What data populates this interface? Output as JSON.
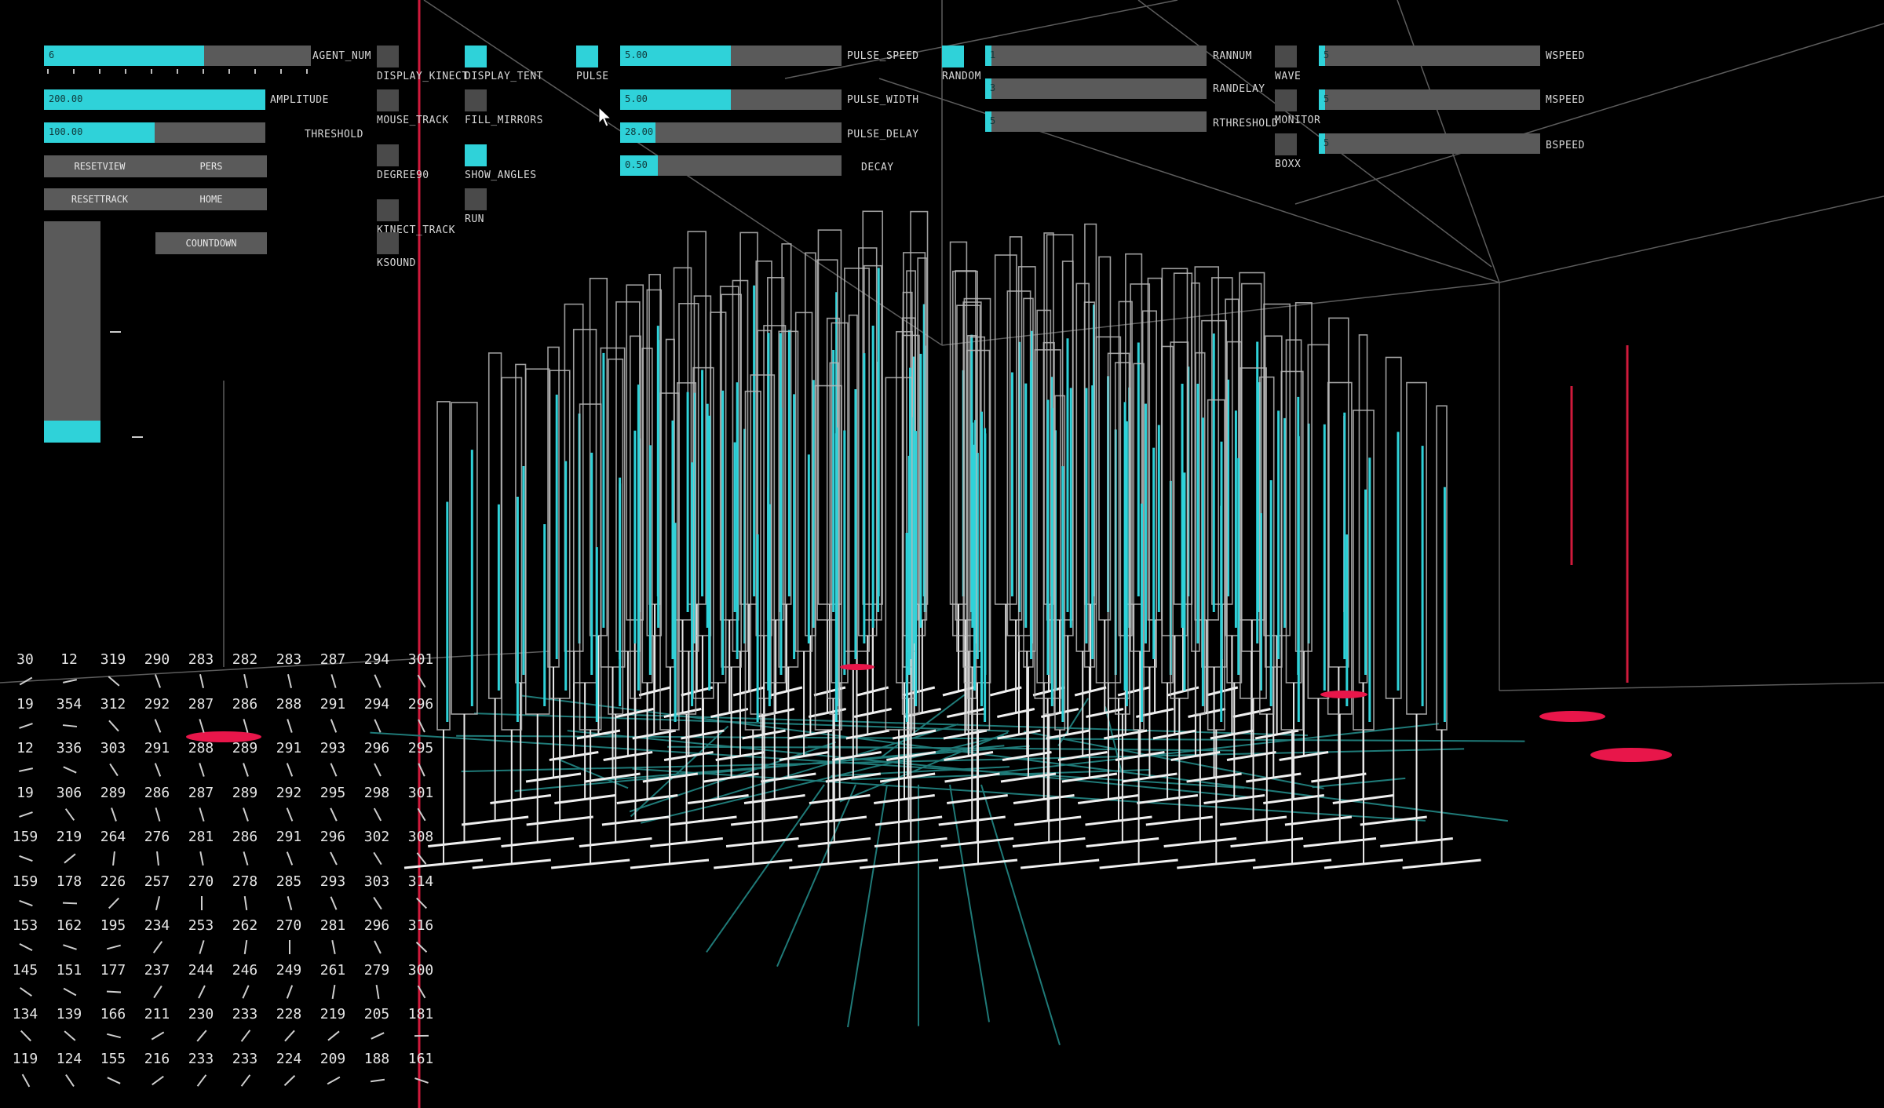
{
  "sliders": [
    {
      "id": "agent-num",
      "label": "AGENT_NUM",
      "value": "6",
      "fraction": 0.6
    },
    {
      "id": "amplitude",
      "label": "AMPLITUDE",
      "value": "200.00",
      "fraction": 1.0
    },
    {
      "id": "threshold",
      "label": "THRESHOLD",
      "value": "100.00",
      "fraction": 0.5
    },
    {
      "id": "pulse-speed",
      "label": "PULSE_SPEED",
      "value": "5.00",
      "fraction": 0.5
    },
    {
      "id": "pulse-width",
      "label": "PULSE_WIDTH",
      "value": "5.00",
      "fraction": 0.5
    },
    {
      "id": "pulse-delay",
      "label": "PULSE_DELAY",
      "value": "28.00",
      "fraction": 0.16
    },
    {
      "id": "decay",
      "label": "DECAY",
      "value": "0.50",
      "fraction": 0.17
    },
    {
      "id": "rannum",
      "label": "RANNUM",
      "value": "1",
      "fraction": 0.02
    },
    {
      "id": "randelay",
      "label": "RANDELAY",
      "value": "3",
      "fraction": 0.02
    },
    {
      "id": "rthreshold",
      "label": "RTHRESHOLD",
      "value": "5",
      "fraction": 0.02
    },
    {
      "id": "wspeed",
      "label": "WSPEED",
      "value": "5",
      "fraction": 0.02
    },
    {
      "id": "mspeed",
      "label": "MSPEED",
      "value": "5",
      "fraction": 0.02
    },
    {
      "id": "bspeed",
      "label": "BSPEED",
      "value": "5",
      "fraction": 0.02
    }
  ],
  "toggles": [
    {
      "id": "display-kinect",
      "label": "DISPLAY_KINECT",
      "on": false
    },
    {
      "id": "mouse-track",
      "label": "MOUSE_TRACK",
      "on": false
    },
    {
      "id": "degree90",
      "label": "DEGREE90",
      "on": false
    },
    {
      "id": "kinect-track",
      "label": "KINECT_TRACK",
      "on": false
    },
    {
      "id": "ksound",
      "label": "KSOUND",
      "on": false
    },
    {
      "id": "display-tent",
      "label": "DISPLAY_TENT",
      "on": true
    },
    {
      "id": "fill-mirrors",
      "label": "FILL_MIRRORS",
      "on": false
    },
    {
      "id": "show-angles",
      "label": "SHOW_ANGLES",
      "on": true
    },
    {
      "id": "run",
      "label": "RUN",
      "on": false
    },
    {
      "id": "pulse",
      "label": "PULSE",
      "on": true
    },
    {
      "id": "random",
      "label": "RANDOM",
      "on": true
    },
    {
      "id": "wave",
      "label": "WAVE",
      "on": false
    },
    {
      "id": "monitor",
      "label": "MONITOR",
      "on": false
    },
    {
      "id": "boxx",
      "label": "BOXX",
      "on": false
    }
  ],
  "buttons": [
    {
      "id": "resetview",
      "label": "RESETVIEW"
    },
    {
      "id": "pers",
      "label": "PERS"
    },
    {
      "id": "resettrack",
      "label": "RESETTRACK"
    },
    {
      "id": "home",
      "label": "HOME"
    },
    {
      "id": "countdown",
      "label": "COUNTDOWN"
    }
  ],
  "vertical_slider": {
    "fraction": 0.1
  },
  "angle_grid": [
    [
      30,
      12,
      319,
      290,
      283,
      282,
      283,
      287,
      294,
      301
    ],
    [
      19,
      354,
      312,
      292,
      287,
      286,
      288,
      291,
      294,
      296
    ],
    [
      12,
      336,
      303,
      291,
      288,
      289,
      291,
      293,
      296,
      295
    ],
    [
      19,
      306,
      289,
      286,
      287,
      289,
      292,
      295,
      298,
      301
    ],
    [
      159,
      219,
      264,
      276,
      281,
      286,
      291,
      296,
      302,
      308
    ],
    [
      159,
      178,
      226,
      257,
      270,
      278,
      285,
      293,
      303,
      314
    ],
    [
      153,
      162,
      195,
      234,
      253,
      262,
      270,
      281,
      296,
      316
    ],
    [
      145,
      151,
      177,
      237,
      244,
      246,
      249,
      261,
      279,
      300
    ],
    [
      134,
      139,
      166,
      211,
      230,
      233,
      228,
      219,
      205,
      181
    ],
    [
      119,
      124,
      155,
      216,
      233,
      233,
      224,
      209,
      188,
      161
    ]
  ],
  "colors": {
    "accent": "#2fd2d9",
    "panel": "#5a5a5a",
    "marker": "#e8164a",
    "floor": "#1f7a78"
  }
}
